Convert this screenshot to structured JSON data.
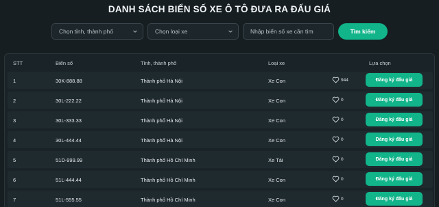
{
  "header": {
    "title": "DANH SÁCH BIỂN SỐ XE Ô TÔ ĐƯA RA ĐẤU GIÁ"
  },
  "filters": {
    "province_placeholder": "Chọn tỉnh, thành phố",
    "vehicle_type_placeholder": "Chọn loại xe",
    "search_placeholder": "Nhập biển số xe cần tìm",
    "search_button": "Tìm kiếm"
  },
  "table": {
    "columns": [
      "STT",
      "Biển số",
      "Tỉnh, thành phố",
      "Loại xe",
      "Lựa chọn"
    ],
    "rows": [
      {
        "stt": "1",
        "plate": "30K-888.88",
        "province": "Thành phố Hà Nội",
        "type": "Xe Con",
        "likes": "944",
        "action": "Đăng ký đấu giá"
      },
      {
        "stt": "2",
        "plate": "30L-222.22",
        "province": "Thành phố Hà Nội",
        "type": "Xe Con",
        "likes": "0",
        "action": "Đăng ký đấu giá"
      },
      {
        "stt": "3",
        "plate": "30L-333.33",
        "province": "Thành phố Hà Nội",
        "type": "Xe Con",
        "likes": "0",
        "action": "Đăng ký đấu giá"
      },
      {
        "stt": "4",
        "plate": "30L-444.44",
        "province": "Thành phố Hà Nội",
        "type": "Xe Con",
        "likes": "0",
        "action": "Đăng ký đấu giá"
      },
      {
        "stt": "5",
        "plate": "51D-999.99",
        "province": "Thành phố Hồ Chí Minh",
        "type": "Xe Tải",
        "likes": "0",
        "action": "Đăng ký đấu giá"
      },
      {
        "stt": "6",
        "plate": "51L-444.44",
        "province": "Thành phố Hồ Chí Minh",
        "type": "Xe Con",
        "likes": "0",
        "action": "Đăng ký đấu giá"
      },
      {
        "stt": "7",
        "plate": "51L-555.55",
        "province": "Thành phố Hồ Chí Minh",
        "type": "Xe Con",
        "likes": "0",
        "action": "Đăng ký đấu giá"
      }
    ]
  },
  "icons": {
    "like": "heart-icon",
    "dropdown": "chevron-down-icon"
  },
  "colors": {
    "accent": "#12b48a",
    "background": "#161e22"
  }
}
